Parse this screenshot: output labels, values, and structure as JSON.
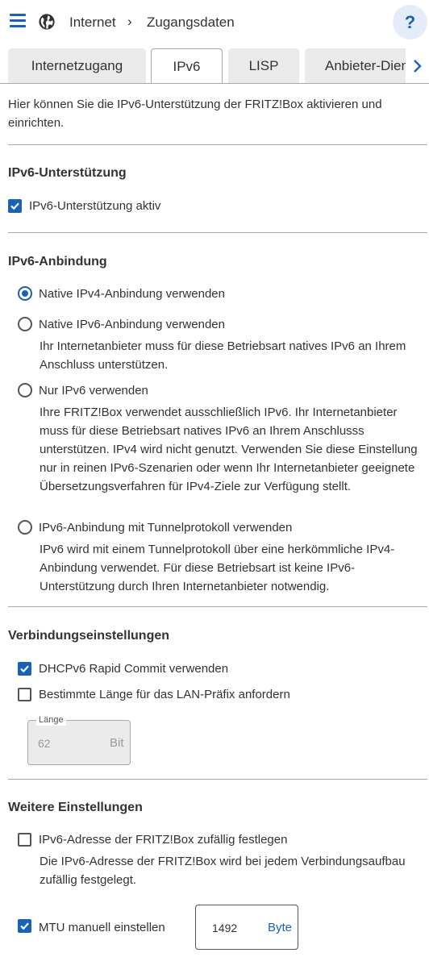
{
  "header": {
    "breadcrumb_root": "Internet",
    "breadcrumb_separator": "›",
    "breadcrumb_current": "Zugangsdaten",
    "help_label": "?"
  },
  "tabs": [
    {
      "label": "Internetzugang",
      "active": false
    },
    {
      "label": "IPv6",
      "active": true
    },
    {
      "label": "LISP",
      "active": false
    },
    {
      "label": "Anbieter-Dienste",
      "active": false
    }
  ],
  "intro": "Hier können Sie die IPv6-Unterstützung der FRITZ!Box aktivieren und einrichten.",
  "support": {
    "title": "IPv6-Unterstützung",
    "checkbox_label": "IPv6-Unterstützung aktiv",
    "checked": true
  },
  "binding": {
    "title": "IPv6-Anbindung",
    "options": [
      {
        "label": "Native IPv4-Anbindung verwenden",
        "selected": true,
        "description": ""
      },
      {
        "label": "Native IPv6-Anbindung verwenden",
        "selected": false,
        "description": "Ihr Internetanbieter muss für diese Betriebsart natives IPv6 an Ihrem Anschluss unterstützen."
      },
      {
        "label": "Nur IPv6 verwenden",
        "selected": false,
        "description": "Ihre FRITZ!Box verwendet ausschließlich IPv6. Ihr Internetanbieter muss für diese Betriebsart natives IPv6 an Ihrem Anschlusss unterstützen. IPv4 wird nicht genutzt. Verwenden Sie diese Einstellung nur in reinen IPv6-Szenarien oder wenn Ihr Internetanbieter geeignete Übersetzungsverfahren für IPv4-Ziele zur Verfügung stellt."
      },
      {
        "label": "IPv6-Anbindung mit Tunnelprotokoll verwenden",
        "selected": false,
        "description": "IPv6 wird mit einem Tunnelprotokoll über eine herkömmliche IPv4-Anbindung verwendet. Für diese Betriebsart ist keine IPv6-Unterstützung durch Ihren Internetanbieter notwendig."
      }
    ]
  },
  "connection": {
    "title": "Verbindungseinstellungen",
    "rapid_commit_label": "DHCPv6 Rapid Commit verwenden",
    "rapid_commit_checked": true,
    "prefix_label": "Bestimmte Länge für das LAN-Präfix anfordern",
    "prefix_checked": false,
    "length_legend": "Länge",
    "length_value": "62",
    "length_unit": "Bit"
  },
  "further": {
    "title": "Weitere Einstellungen",
    "random_label": "IPv6-Adresse der FRITZ!Box zufällig festlegen",
    "random_checked": false,
    "random_description": "Die IPv6-Adresse der FRITZ!Box wird bei jedem Verbindungsaufbau zufällig festgelegt.",
    "mtu_label": "MTU manuell einstellen",
    "mtu_checked": true,
    "mtu_value": "1492",
    "mtu_unit": "Byte"
  },
  "colors": {
    "accent": "#1a62b8",
    "help_bg": "#e3ecf7",
    "tab_inactive": "#eaeaea",
    "divider": "#a8a8a8",
    "disabled_field": "#ebebeb"
  },
  "icons": {
    "menu": "hamburger-icon",
    "globe": "globe-icon",
    "next": "chevron-right-icon",
    "check": "checkmark-icon"
  }
}
